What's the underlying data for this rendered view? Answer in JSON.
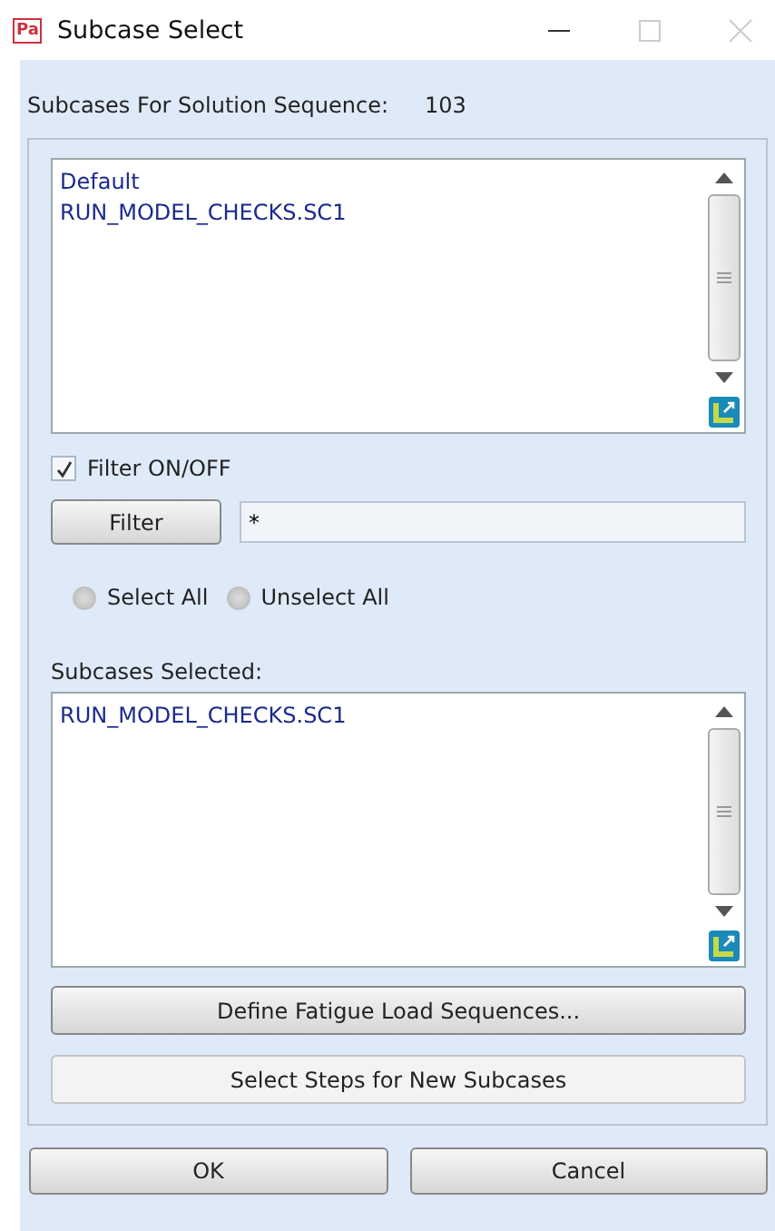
{
  "window": {
    "icon_text": "Pa",
    "title": "Subcase Select"
  },
  "solution_sequence": {
    "label": "Subcases For Solution Sequence:",
    "value": "103"
  },
  "available_list": {
    "items": [
      {
        "label": "Default",
        "selected": false
      },
      {
        "label": "RUN_MODEL_CHECKS.SC1",
        "selected": false
      }
    ]
  },
  "filter_toggle": {
    "label": "Filter ON/OFF",
    "checked": true
  },
  "filter": {
    "button": "Filter",
    "value": "*"
  },
  "selection_radios": [
    {
      "label": "Select All",
      "selected": false
    },
    {
      "label": "Unselect All",
      "selected": false
    }
  ],
  "selected_list": {
    "label": "Subcases Selected:",
    "items": [
      {
        "label": "RUN_MODEL_CHECKS.SC1",
        "selected": false
      }
    ]
  },
  "action_buttons": [
    {
      "label": "Define Fatigue Load Sequences...",
      "kind": "raised"
    },
    {
      "label": "Select Steps for New Subcases",
      "kind": "flat"
    }
  ],
  "dialog_buttons": [
    "OK",
    "Cancel"
  ]
}
